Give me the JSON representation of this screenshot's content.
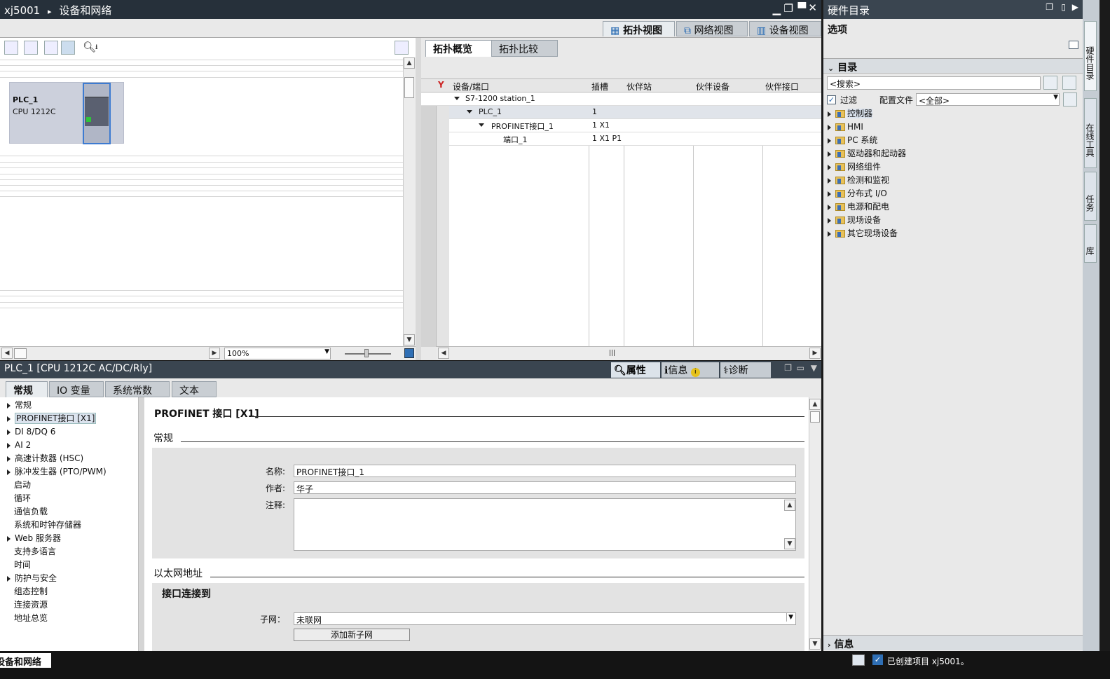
{
  "title_bar": {
    "project": "xj5001",
    "separator": "▸",
    "editor": "设备和网络"
  },
  "view_tabs": [
    {
      "label": "拓扑视图",
      "active": true
    },
    {
      "label": "网络视图",
      "active": false
    },
    {
      "label": "设备视图",
      "active": false
    }
  ],
  "device": {
    "name": "PLC_1",
    "type": "CPU 1212C"
  },
  "zoom": "100%",
  "subtabs": [
    {
      "label": "拓扑概览",
      "active": true
    },
    {
      "label": "拓扑比较",
      "active": false
    }
  ],
  "grid": {
    "headers": [
      "设备/端口",
      "插槽",
      "伙伴站",
      "伙伴设备",
      "伙伴接口"
    ],
    "rows": [
      {
        "name": "S7-1200 station_1",
        "slot": ""
      },
      {
        "name": "PLC_1",
        "slot": "1"
      },
      {
        "name": "PROFINET接口_1",
        "slot": "1 X1"
      },
      {
        "name": "端口_1",
        "slot": "1 X1 P1"
      }
    ]
  },
  "inspector": {
    "title": "PLC_1 [CPU 1212C AC/DC/Rly]",
    "right_tabs": [
      "属性",
      "信息",
      "诊断"
    ],
    "tabs": [
      {
        "label": "常规",
        "active": true
      },
      {
        "label": "IO 变量"
      },
      {
        "label": "系统常数"
      },
      {
        "label": "文本"
      }
    ],
    "nav": [
      {
        "label": "常规",
        "arrow": true
      },
      {
        "label": "PROFINET接口 [X1]",
        "arrow": true,
        "selected": true
      },
      {
        "label": "DI 8/DQ 6",
        "arrow": true
      },
      {
        "label": "AI 2",
        "arrow": true
      },
      {
        "label": "高速计数器 (HSC)",
        "arrow": true
      },
      {
        "label": "脉冲发生器 (PTO/PWM)",
        "arrow": true
      },
      {
        "label": "启动",
        "arrow": false
      },
      {
        "label": "循环",
        "arrow": false
      },
      {
        "label": "通信负载",
        "arrow": false
      },
      {
        "label": "系统和时钟存储器",
        "arrow": false
      },
      {
        "label": "Web 服务器",
        "arrow": true
      },
      {
        "label": "支持多语言",
        "arrow": false
      },
      {
        "label": "时间",
        "arrow": false
      },
      {
        "label": "防护与安全",
        "arrow": true
      },
      {
        "label": "组态控制",
        "arrow": false
      },
      {
        "label": "连接资源",
        "arrow": false
      },
      {
        "label": "地址总览",
        "arrow": false
      }
    ],
    "content_title": "PROFINET 接口 [X1]",
    "section_general": "常规",
    "name_label": "名称:",
    "name_value": "PROFINET接口_1",
    "author_label": "作者:",
    "author_value": "华子",
    "comment_label": "注释:",
    "comment_value": "",
    "section_ethernet": "以太网地址",
    "sub_section": "接口连接到",
    "subnet_label": "子网：",
    "subnet_value": "未联网",
    "add_subnet": "添加新子网"
  },
  "catalog": {
    "title": "硬件目录",
    "options": "选项",
    "section": "目录",
    "search_placeholder": "<搜索>",
    "filter_label": "过滤",
    "filter_checked": true,
    "profile_label": "配置文件",
    "profile_value": "<全部>",
    "items": [
      "控制器",
      "HMI",
      "PC 系统",
      "驱动器和起动器",
      "网络组件",
      "检测和监视",
      "分布式 I/O",
      "电源和配电",
      "现场设备",
      "其它现场设备"
    ],
    "info": "信息",
    "side_tabs": [
      "硬件目录",
      "在线工具",
      "任务",
      "库"
    ]
  },
  "statusbar": {
    "left": "设备和网络",
    "right": "已创建项目 xj5001。"
  },
  "colors": {
    "titlebar": "#26303a",
    "accent": "#2f6fb5"
  }
}
